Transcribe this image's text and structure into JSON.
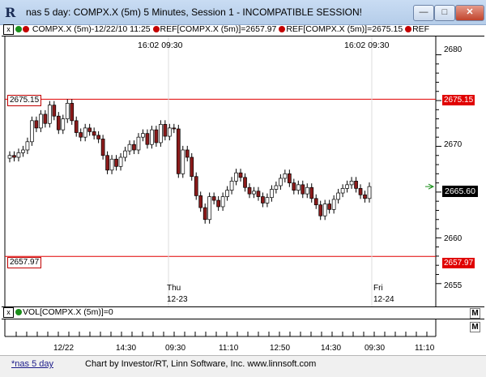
{
  "window": {
    "app_icon_glyph": "R",
    "title": "nas 5 day: COMPX.X (5m) 5 Minutes, Session 1 - INCOMPATIBLE SESSION!",
    "buttons": {
      "minimize": "—",
      "maximize": "□",
      "close": "✕"
    }
  },
  "legend": {
    "prefix_close": "x",
    "series_label": "COMPX.X (5m)-12/22/10 11:25",
    "ref1": "REF[COMPX.X (5m)]=2657.97",
    "ref2": "REF[COMPX.X (5m)]=2675.15",
    "ref3": "REF",
    "dot_colors": [
      "#1a8f1a",
      "#c40000"
    ]
  },
  "time_readouts": {
    "left": "16:02  09:30",
    "right": "16:02  09:30"
  },
  "price_axis": {
    "ticks": [
      "2680",
      "2670",
      "2660",
      "2655"
    ],
    "ref_upper": "2675.15",
    "ref_lower": "2657.97",
    "current": "2665.60",
    "left_flag_upper": "2675.15",
    "left_flag_lower": "2657.97"
  },
  "day_labels": [
    {
      "day": "Thu",
      "date": "12-23"
    },
    {
      "day": "Fri",
      "date": "12-24"
    }
  ],
  "volume": {
    "close": "x",
    "label": "VOL[COMPX.X (5m)]=0",
    "m_button": "M"
  },
  "time_axis": {
    "ticks": [
      "12/22",
      "14:30",
      "09:30",
      "11:10",
      "12:50",
      "14:30",
      "09:30",
      "11:10"
    ],
    "m_button": "M"
  },
  "status": {
    "tab": "*nas 5 day",
    "credit": "Chart by Investor/RT, Linn Software, Inc. www.linnsoft.com"
  },
  "colors": {
    "ref_line": "#e00000",
    "candle_down": "#8b1a1a",
    "candle_up": "#ffffff",
    "current_arrow": "#1a8f1a"
  },
  "chart_data": {
    "type": "candlestick",
    "ylim": [
      2652.5,
      2682
    ],
    "ref_lines": [
      2675.15,
      2657.97
    ],
    "current_price": 2665.6,
    "close_series": [
      2669.0,
      2668.8,
      2669.3,
      2669.6,
      2670.5,
      2672.8,
      2672.0,
      2673.5,
      2672.5,
      2674.5,
      2673.3,
      2671.8,
      2673.0,
      2674.7,
      2672.8,
      2671.5,
      2671.0,
      2672.0,
      2671.6,
      2671.2,
      2670.8,
      2669.0,
      2667.4,
      2668.6,
      2667.8,
      2668.8,
      2669.5,
      2670.2,
      2669.6,
      2671.0,
      2671.4,
      2670.2,
      2671.8,
      2670.4,
      2672.4,
      2671.1,
      2672.0,
      2671.9,
      2667.0,
      2669.6,
      2668.8,
      2666.7,
      2664.6,
      2663.3,
      2662.0,
      2664.5,
      2664.1,
      2663.4,
      2664.5,
      2665.2,
      2666.2,
      2667.1,
      2666.6,
      2665.5,
      2664.8,
      2665.1,
      2664.5,
      2663.8,
      2664.4,
      2665.3,
      2665.7,
      2666.5,
      2667.0,
      2666.0,
      2665.2,
      2665.8,
      2664.8,
      2665.5,
      2664.3,
      2663.6,
      2662.4,
      2663.7,
      2663.1,
      2664.2,
      2664.9,
      2665.4,
      2665.8,
      2666.2,
      2665.4,
      2664.7,
      2664.3,
      2665.6
    ]
  }
}
